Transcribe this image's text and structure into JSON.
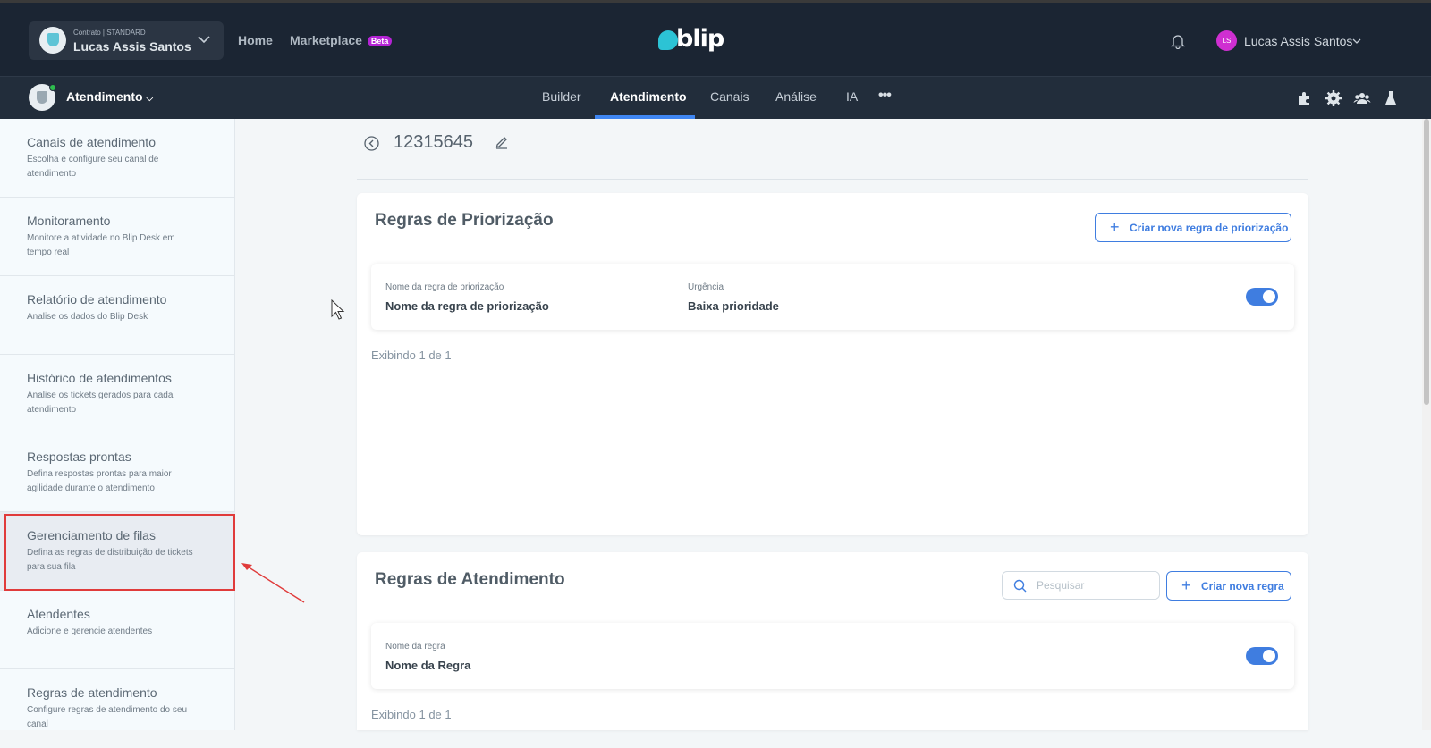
{
  "header": {
    "contract_label": "Contrato | STANDARD",
    "contract_name": "Lucas Assis Santos",
    "home": "Home",
    "marketplace": "Marketplace",
    "beta": "Beta",
    "logo_text": "blip",
    "user_initials": "LS",
    "user_name": "Lucas Assis Santos"
  },
  "nav": {
    "service_name": "Atendimento",
    "tabs": [
      {
        "label": "Builder"
      },
      {
        "label": "Atendimento"
      },
      {
        "label": "Canais"
      },
      {
        "label": "Análise"
      },
      {
        "label": "IA"
      }
    ],
    "more": "•••",
    "active_tab": "Atendimento"
  },
  "sidebar": {
    "items": [
      {
        "title": "Canais de atendimento",
        "desc": "Escolha e configure seu canal de atendimento"
      },
      {
        "title": "Monitoramento",
        "desc": "Monitore a atividade no Blip Desk em tempo real"
      },
      {
        "title": "Relatório de atendimento",
        "desc": "Analise os dados do Blip Desk"
      },
      {
        "title": "Histórico de atendimentos",
        "desc": "Analise os tickets gerados para cada atendimento"
      },
      {
        "title": "Respostas prontas",
        "desc": "Defina respostas prontas para maior agilidade durante o atendimento"
      },
      {
        "title": "Gerenciamento de filas",
        "desc": "Defina as regras de distribuição de tickets para sua fila"
      },
      {
        "title": "Atendentes",
        "desc": "Adicione e gerencie atendentes"
      },
      {
        "title": "Regras de atendimento",
        "desc": "Configure regras de atendimento do seu canal"
      }
    ],
    "selected": "Gerenciamento de filas"
  },
  "main": {
    "queue_name": "12315645",
    "priority": {
      "title": "Regras de Priorização",
      "create_button": "Criar nova regra de priorização",
      "rule": {
        "name_label": "Nome da regra de priorização",
        "name_value": "Nome da regra de priorização",
        "urgency_label": "Urgência",
        "urgency_value": "Baixa prioridade",
        "enabled": true
      },
      "count_text": "Exibindo 1 de 1"
    },
    "attendance": {
      "title": "Regras de Atendimento",
      "search_placeholder": "Pesquisar",
      "create_button": "Criar nova regra",
      "rule": {
        "name_label": "Nome da regra",
        "name_value": "Nome da Regra",
        "enabled": true
      },
      "count_text": "Exibindo 1 de 1"
    }
  },
  "colors": {
    "header_bg": "#1b2533",
    "nav_bg": "#222d3b",
    "accent": "#3f7de0",
    "beta_badge": "#b523d6",
    "avatar": "#cf2fd1",
    "highlight": "#e03b3b"
  }
}
